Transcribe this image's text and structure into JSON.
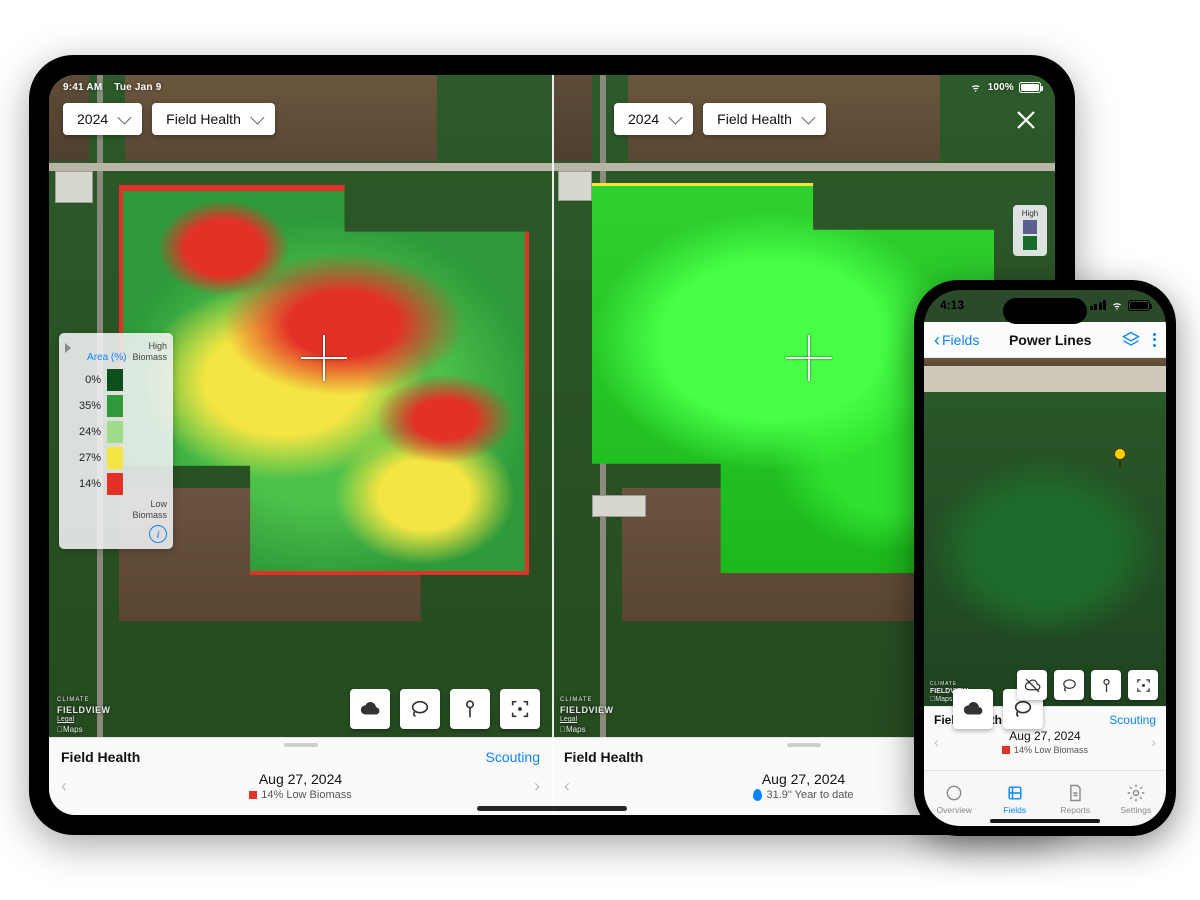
{
  "ipad": {
    "status": {
      "time": "9:41 AM",
      "date": "Tue Jan 9",
      "battery_pct": "100%"
    },
    "left": {
      "year": "2024",
      "layer": "Field Health",
      "legend": {
        "area_label": "Area (%)",
        "high_line1": "High",
        "high_line2": "Biomass",
        "rows": [
          {
            "pct": "0%",
            "color": "#0d4f1a"
          },
          {
            "pct": "35%",
            "color": "#2e9a3a"
          },
          {
            "pct": "24%",
            "color": "#9edc8a"
          },
          {
            "pct": "27%",
            "color": "#f4e542"
          },
          {
            "pct": "14%",
            "color": "#e33127"
          }
        ],
        "low_line1": "Low",
        "low_line2": "Biomass"
      },
      "attribution": {
        "brand_top": "CLIMATE",
        "brand": "FIELDVIEW",
        "legal": "Legal",
        "maps": "Maps"
      },
      "sheet": {
        "title": "Field Health",
        "link": "Scouting",
        "date": "Aug 27, 2024",
        "sub": "14% Low Biomass"
      }
    },
    "right": {
      "year": "2024",
      "layer": "Field Health",
      "legend_mini": {
        "label": "High"
      },
      "attribution": {
        "brand_top": "CLIMATE",
        "brand": "FIELDVIEW",
        "legal": "Legal",
        "maps": "Maps"
      },
      "sheet": {
        "title": "Field Health",
        "date": "Aug 27, 2024",
        "sub": "31.9\" Year to date"
      }
    }
  },
  "iphone": {
    "status": {
      "time": "4:13"
    },
    "nav": {
      "back": "Fields",
      "title": "Power Lines"
    },
    "attribution": {
      "brand_top": "CLIMATE",
      "brand": "FIELDVIEW",
      "legal": "Legal",
      "maps": "Maps"
    },
    "sheet": {
      "title": "Field Health",
      "link": "Scouting",
      "date": "Aug 27, 2024",
      "sub": "14% Low Biomass"
    },
    "tabs": [
      {
        "label": "Overview"
      },
      {
        "label": "Fields"
      },
      {
        "label": "Reports"
      },
      {
        "label": "Settings"
      }
    ]
  },
  "colors": {
    "accent": "#0a84ff"
  }
}
